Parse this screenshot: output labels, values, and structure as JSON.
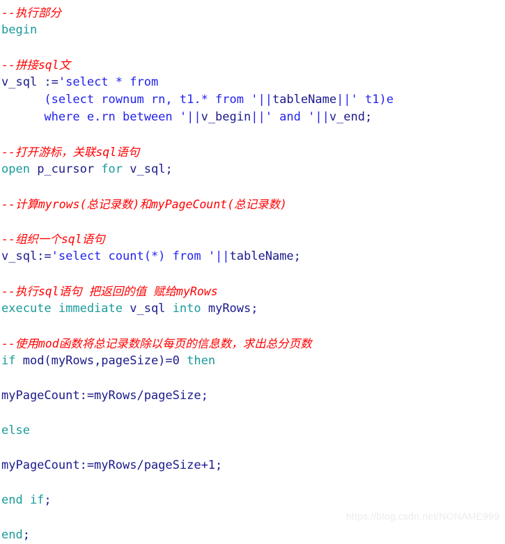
{
  "document": {
    "type": "code-snippet",
    "language": "PL/SQL",
    "background_color": "#ffffff",
    "colors": {
      "comment": "#ff0000",
      "keyword": "#1a9a9a",
      "identifier": "#1a1a8c",
      "string": "#2222ee",
      "watermark": "#ececec"
    }
  },
  "watermark": {
    "text": "https://blog.csdn.net/NONAME999"
  },
  "code": {
    "lines": [
      {
        "index": 1,
        "text": "--执行部分",
        "tokens": [
          {
            "t": "--执行部分",
            "k": "cmt"
          }
        ]
      },
      {
        "index": 2,
        "text": "begin",
        "tokens": [
          {
            "t": "begin",
            "k": "kw"
          }
        ]
      },
      {
        "index": 3,
        "text": "",
        "tokens": []
      },
      {
        "index": 4,
        "text": "--拼接sql文",
        "tokens": [
          {
            "t": "--拼接sql文",
            "k": "cmt"
          }
        ]
      },
      {
        "index": 5,
        "text": "v_sql :='select * from",
        "tokens": [
          {
            "t": "v_sql :=",
            "k": "id"
          },
          {
            "t": "'select * from",
            "k": "str"
          }
        ]
      },
      {
        "index": 6,
        "text": "      (select rownum rn, t1.* from '||tableName||' t1)e",
        "tokens": [
          {
            "t": "      (select rownum rn, t1.* from '||",
            "k": "str"
          },
          {
            "t": "tableName",
            "k": "id"
          },
          {
            "t": "||' t1)e",
            "k": "str"
          }
        ]
      },
      {
        "index": 7,
        "text": "      where e.rn between '||v_begin||' and '||v_end;",
        "tokens": [
          {
            "t": "      where e.rn between '||",
            "k": "str"
          },
          {
            "t": "v_begin",
            "k": "id"
          },
          {
            "t": "||' and '||",
            "k": "str"
          },
          {
            "t": "v_end;",
            "k": "id"
          }
        ]
      },
      {
        "index": 8,
        "text": "",
        "tokens": []
      },
      {
        "index": 9,
        "text": "--打开游标，关联sql语句",
        "tokens": [
          {
            "t": "--打开游标，关联sql语句",
            "k": "cmt"
          }
        ]
      },
      {
        "index": 10,
        "text": "open p_cursor for v_sql;",
        "tokens": [
          {
            "t": "open ",
            "k": "kw"
          },
          {
            "t": "p_cursor ",
            "k": "id"
          },
          {
            "t": "for ",
            "k": "kw"
          },
          {
            "t": "v_sql;",
            "k": "id"
          }
        ]
      },
      {
        "index": 11,
        "text": "",
        "tokens": []
      },
      {
        "index": 12,
        "text": "--计算myrows(总记录数)和myPageCount(总记录数)",
        "tokens": [
          {
            "t": "--计算myrows(总记录数)和myPageCount(总记录数)",
            "k": "cmt"
          }
        ]
      },
      {
        "index": 13,
        "text": "",
        "tokens": []
      },
      {
        "index": 14,
        "text": "--组织一个sql语句",
        "tokens": [
          {
            "t": "--组织一个sql语句",
            "k": "cmt"
          }
        ]
      },
      {
        "index": 15,
        "text": "v_sql:='select count(*) from '||tableName;",
        "tokens": [
          {
            "t": "v_sql:=",
            "k": "id"
          },
          {
            "t": "'select count(*) from '||",
            "k": "str"
          },
          {
            "t": "tableName;",
            "k": "id"
          }
        ]
      },
      {
        "index": 16,
        "text": "",
        "tokens": []
      },
      {
        "index": 17,
        "text": "--执行sql语句 把返回的值 赋给myRows",
        "tokens": [
          {
            "t": "--执行sql语句 把返回的值 赋给myRows",
            "k": "cmt"
          }
        ]
      },
      {
        "index": 18,
        "text": "execute immediate v_sql into myRows;",
        "tokens": [
          {
            "t": "execute immediate ",
            "k": "kw"
          },
          {
            "t": "v_sql ",
            "k": "id"
          },
          {
            "t": "into ",
            "k": "kw"
          },
          {
            "t": "myRows;",
            "k": "id"
          }
        ]
      },
      {
        "index": 19,
        "text": "",
        "tokens": []
      },
      {
        "index": 20,
        "text": "--使用mod函数将总记录数除以每页的信息数，求出总分页数",
        "tokens": [
          {
            "t": "--使用mod函数将总记录数除以每页的信息数，求出总分页数",
            "k": "cmt"
          }
        ]
      },
      {
        "index": 21,
        "text": "if mod(myRows,pageSize)=0 then",
        "tokens": [
          {
            "t": "if ",
            "k": "kw"
          },
          {
            "t": "mod(myRows,pageSize)=0 ",
            "k": "id"
          },
          {
            "t": "then",
            "k": "kw"
          }
        ]
      },
      {
        "index": 22,
        "text": "",
        "tokens": []
      },
      {
        "index": 23,
        "text": "myPageCount:=myRows/pageSize;",
        "tokens": [
          {
            "t": "myPageCount:=myRows/pageSize;",
            "k": "id"
          }
        ]
      },
      {
        "index": 24,
        "text": "",
        "tokens": []
      },
      {
        "index": 25,
        "text": "else",
        "tokens": [
          {
            "t": "else",
            "k": "kw"
          }
        ]
      },
      {
        "index": 26,
        "text": "",
        "tokens": []
      },
      {
        "index": 27,
        "text": "myPageCount:=myRows/pageSize+1;",
        "tokens": [
          {
            "t": "myPageCount:=myRows/pageSize+1;",
            "k": "id"
          }
        ]
      },
      {
        "index": 28,
        "text": "",
        "tokens": []
      },
      {
        "index": 29,
        "text": "end if;",
        "tokens": [
          {
            "t": "end if",
            "k": "kw"
          },
          {
            "t": ";",
            "k": "id"
          }
        ]
      },
      {
        "index": 30,
        "text": "",
        "tokens": []
      },
      {
        "index": 31,
        "text": "end;",
        "tokens": [
          {
            "t": "end",
            "k": "kw"
          },
          {
            "t": ";",
            "k": "id"
          }
        ]
      }
    ]
  }
}
